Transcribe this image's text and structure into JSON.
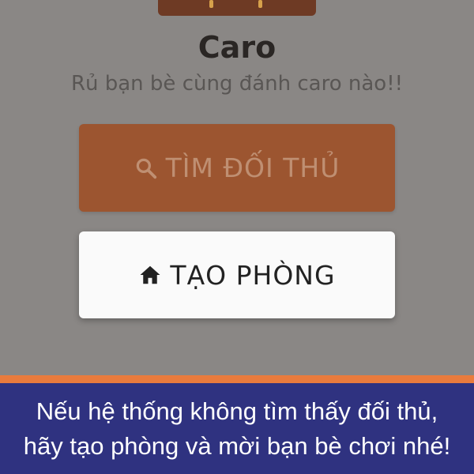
{
  "header": {
    "title": "Caro",
    "subtitle": "Rủ bạn bè cùng đánh caro nào!!"
  },
  "actions": {
    "find_opponent": {
      "label": "TÌM ĐỐI THỦ",
      "icon": "search-icon"
    },
    "create_room": {
      "label": "TẠO PHÒNG",
      "icon": "home-icon"
    }
  },
  "banner": {
    "line1": "Nếu hệ thống không tìm thấy đối thủ,",
    "line2": "hãy tạo phòng và mời bạn bè chơi nhé!"
  },
  "colors": {
    "overlay": "#8a8785",
    "find_button": "#9c5530",
    "banner_bg": "#2f3280",
    "banner_stripe": "#e97b3d"
  }
}
